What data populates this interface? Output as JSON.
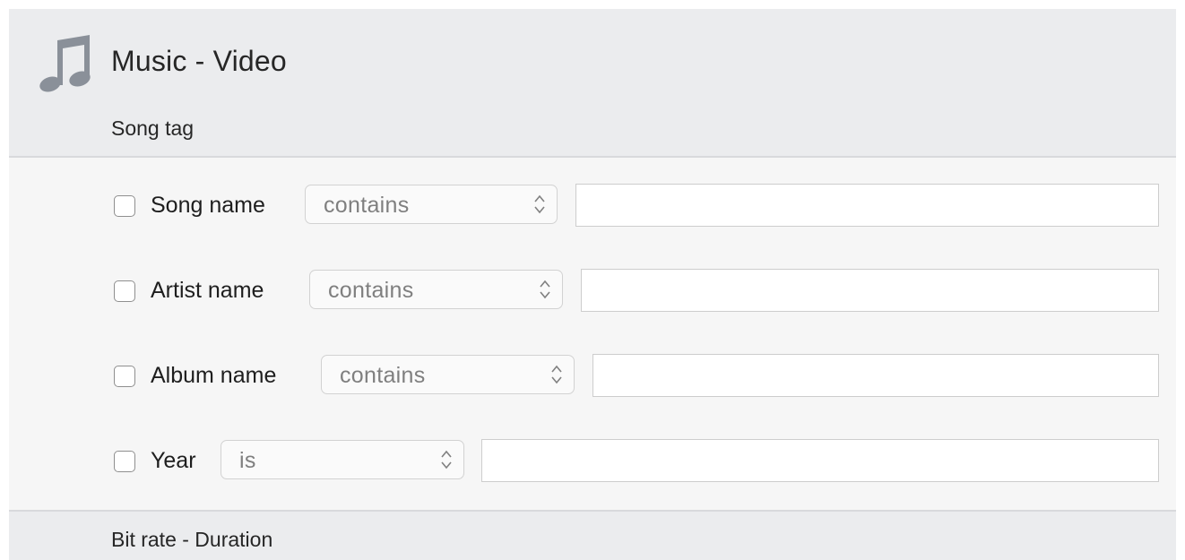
{
  "header": {
    "title": "Music - Video",
    "icon": "music-note-icon",
    "section_label": "Song tag"
  },
  "filters": [
    {
      "label": "Song name",
      "checked": false,
      "operator": "contains",
      "value": ""
    },
    {
      "label": "Artist name",
      "checked": false,
      "operator": "contains",
      "value": ""
    },
    {
      "label": "Album name",
      "checked": false,
      "operator": "contains",
      "value": ""
    },
    {
      "label": "Year",
      "checked": false,
      "operator": "is",
      "value": ""
    }
  ],
  "next_section": {
    "label": "Bit rate - Duration"
  },
  "colors": {
    "header_background": "#ebecee",
    "content_background": "#f6f6f6",
    "icon_gray": "#8a9099"
  }
}
